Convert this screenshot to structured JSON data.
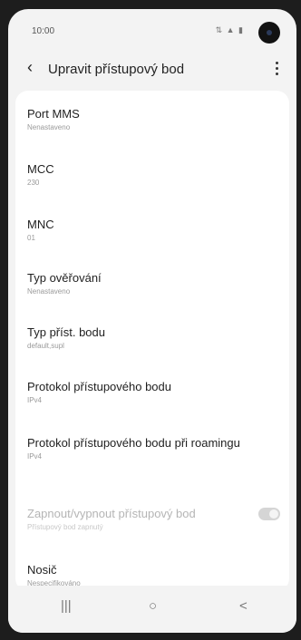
{
  "status": {
    "time": "10:00",
    "icons": "⇅ ▲ ▮"
  },
  "appbar": {
    "title": "Upravit přístupový bod",
    "back_icon": "‹",
    "more_icon": "more-vert-icon"
  },
  "settings": {
    "items": [
      {
        "label": "Port MMS",
        "value": "Nenastaveno"
      },
      {
        "label": "MCC",
        "value": "230"
      },
      {
        "label": "MNC",
        "value": "01"
      },
      {
        "label": "Typ ověřování",
        "value": "Nenastaveno"
      },
      {
        "label": "Typ příst. bodu",
        "value": "default,supl"
      },
      {
        "label": "Protokol přístupového bodu",
        "value": "IPv4"
      },
      {
        "label": "Protokol přístupového bodu při roamingu",
        "value": "IPv4"
      },
      {
        "label": "Zapnout/vypnout přístupový bod",
        "value": "Přístupový bod zapnutý",
        "disabled": true
      },
      {
        "label": "Nosič",
        "value": "Nespecifikováno"
      }
    ]
  },
  "nav": {
    "recents": "|||",
    "home": "○",
    "back": "<"
  }
}
